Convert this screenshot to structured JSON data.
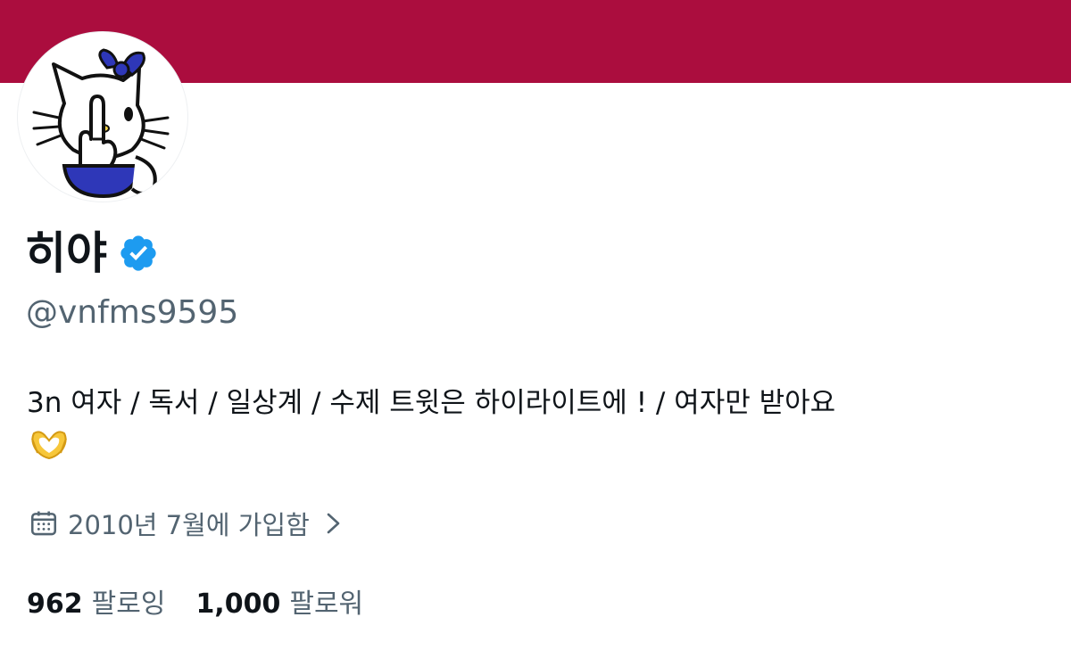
{
  "profile": {
    "display_name": "히야",
    "handle": "@vnfms9595",
    "bio_line1": "3n 여자 / 독서 / 일상계 / 수제 트윗은 하이라이트에 ! / 여자만 받아요",
    "bio_emoji_icon": "heart-hands-icon",
    "joined_text": "2010년 7월에 가입함",
    "verified_icon": "verified-badge-icon",
    "avatar_icon": "hello-kitty-avatar"
  },
  "stats": {
    "following_count": "962",
    "following_label": "팔로잉",
    "followers_count": "1,000",
    "followers_label": "팔로워"
  },
  "colors": {
    "banner": "#ab0d3e",
    "verified": "#1d9bf0",
    "secondary_text": "#536471",
    "primary_text": "#0f1419"
  }
}
